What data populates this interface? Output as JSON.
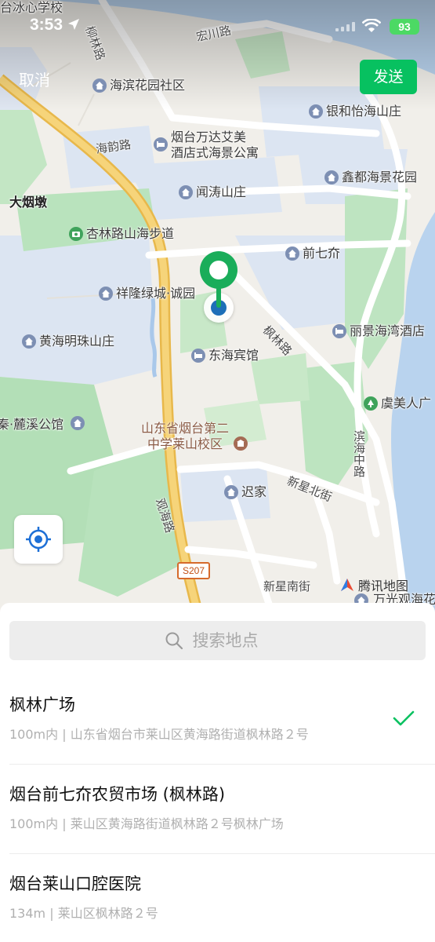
{
  "status_bar": {
    "time": "3:53",
    "battery": "93"
  },
  "header": {
    "cancel": "取消",
    "send": "发送"
  },
  "map": {
    "labels": {
      "school": "台冰心学校",
      "road_liulin": "柳林路",
      "road_hongchuan": "宏川路",
      "road_haiyun": "海韵路",
      "dayandun": "大烟墩",
      "road_fenglin": "枫林路",
      "road_binhai": "滨海中路",
      "road_xinxingbei": "新星北街",
      "road_guanhai": "观海路",
      "road_xinxingnan": "新星南街",
      "s207": "S207",
      "wanguang": "万光观海花",
      "lixi_prefix": "秦·麓溪公馆"
    },
    "pois": {
      "haibin": "海滨花园社区",
      "yinhe": "银和怡海山庄",
      "wanda": "烟台万达艾美\n酒店式海景公寓",
      "xindu": "鑫都海景花园",
      "wentao": "闻涛山庄",
      "xinglin": "杏林路山海步道",
      "qianqijie": "前七夼",
      "xianglong": "祥隆绿城·诚园",
      "lijing": "丽景海湾酒店",
      "huanghai": "黄海明珠山庄",
      "donghai": "东海宾馆",
      "yumei": "虞美人广",
      "school2": "山东省烟台第二\n中学莱山校区",
      "chijia": "迟家"
    },
    "attribution": "腾讯地图"
  },
  "search": {
    "placeholder": "搜索地点"
  },
  "results": [
    {
      "name": "枫林广场",
      "addr": "100m内 | 山东省烟台市莱山区黄海路街道枫林路２号",
      "selected": true
    },
    {
      "name": "烟台前七夼农贸市场 (枫林路)",
      "addr": "100m内 | 莱山区黄海路街道枫林路２号枫林广场",
      "selected": false
    },
    {
      "name": "烟台莱山口腔医院",
      "addr": "134m | 莱山区枫林路２号",
      "selected": false
    }
  ],
  "colors": {
    "accent": "#07c160",
    "pin": "#1aad5a",
    "location_dot": "#1d6fb8"
  }
}
